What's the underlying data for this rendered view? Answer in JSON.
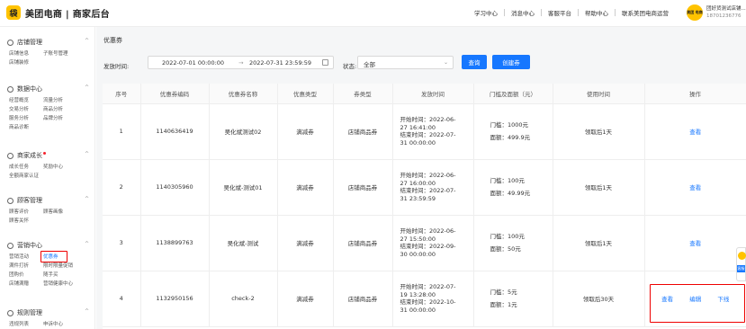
{
  "app": {
    "logo_glyph": "袋",
    "brand": "美团电商 | 商家后台",
    "brand_color": "#FFC300",
    "accent_color": "#1677ff"
  },
  "topnav": {
    "items": [
      "学习中心",
      "消息中心",
      "客服平台",
      "帮助中心",
      "联系美团电商运营"
    ]
  },
  "user": {
    "avatar_text": "美团 电商",
    "name": "团好货测试店铺...",
    "phone": "18701236776"
  },
  "sidebar": {
    "sections": [
      {
        "title": "店铺管理",
        "items": [
          [
            "店铺信息",
            "子账号管理"
          ],
          [
            "店铺装修",
            ""
          ]
        ]
      },
      {
        "title": "数据中心",
        "items": [
          [
            "经营概览",
            "流量分析"
          ],
          [
            "交易分析",
            "商品分析"
          ],
          [
            "服务分析",
            "品牌分析"
          ],
          [
            "商品诊断",
            ""
          ]
        ]
      },
      {
        "title": "商家成长",
        "items": [
          [
            "成长任务",
            "奖励中心"
          ],
          [
            "全额商家认证",
            ""
          ]
        ]
      },
      {
        "title": "顾客管理",
        "items": [
          [
            "顾客评价",
            "顾客画像"
          ],
          [
            "顾客关怀",
            ""
          ]
        ]
      },
      {
        "title": "营销中心",
        "items": [
          [
            "营销活动",
            "优惠券"
          ],
          [
            "满件打折",
            "限时限量促销"
          ],
          [
            "团购价",
            "随手买"
          ],
          [
            "店铺满赠",
            "营销健康中心"
          ]
        ]
      },
      {
        "title": "规则管理",
        "items": [
          [
            "违规列表",
            "申诉中心"
          ]
        ]
      }
    ]
  },
  "main": {
    "breadcrumb": "优惠券",
    "filter": {
      "date_label": "发放时间:",
      "date_start": "2022-07-01 00:00:00",
      "date_arrow": "→",
      "date_end": "2022-07-31 23:59:59",
      "status_label": "状态:",
      "status_value": "全部",
      "query_button": "查询",
      "create_button": "创建券"
    },
    "table": {
      "columns": [
        "序号",
        "优惠券编码",
        "优惠券名称",
        "优惠类型",
        "券类型",
        "发放时间",
        "门槛及面额（元）",
        "使用时间",
        "操作"
      ],
      "rows": [
        {
          "no": "1",
          "code": "1140636419",
          "name": "吴化斌测试02",
          "type": "满减券",
          "coupon_type": "店铺商品券",
          "start": [
            "开始时间：2022-06-",
            "27 16:41:00"
          ],
          "end": [
            "结束时间：2022-07-",
            "31 00:00:00"
          ],
          "threshold": "门槛：1000元",
          "amount": "面额：499.9元",
          "use": "领取后1天",
          "ops": [
            "查看"
          ]
        },
        {
          "no": "2",
          "code": "1140305960",
          "name": "吴化斌-测试01",
          "type": "满减券",
          "coupon_type": "店铺商品券",
          "start": [
            "开始时间：2022-06-",
            "27 16:00:00"
          ],
          "end": [
            "结束时间：2022-07-",
            "31 23:59:59"
          ],
          "threshold": "门槛：100元",
          "amount": "面额：49.99元",
          "use": "领取后1天",
          "ops": [
            "查看"
          ]
        },
        {
          "no": "3",
          "code": "1138899763",
          "name": "吴化斌-测试",
          "type": "满减券",
          "coupon_type": "店铺商品券",
          "start": [
            "开始时间：2022-06-",
            "27 15:50:00"
          ],
          "end": [
            "结束时间：2022-09-",
            "30 00:00:00"
          ],
          "threshold": "门槛：100元",
          "amount": "面额：50元",
          "use": "领取后1天",
          "ops": [
            "查看"
          ]
        },
        {
          "no": "4",
          "code": "1132950156",
          "name": "check-2",
          "type": "满减券",
          "coupon_type": "店铺商品券",
          "start": [
            "开始时间：2022-07-",
            "19 13:28:00"
          ],
          "end": [
            "结束时间：2022-10-",
            "31 00:00:00"
          ],
          "threshold": "门槛：5元",
          "amount": "面额：1元",
          "use": "领取后30天",
          "ops": [
            "查看",
            "编辑",
            "下线"
          ]
        }
      ]
    }
  },
  "float": {
    "label": "客服"
  }
}
